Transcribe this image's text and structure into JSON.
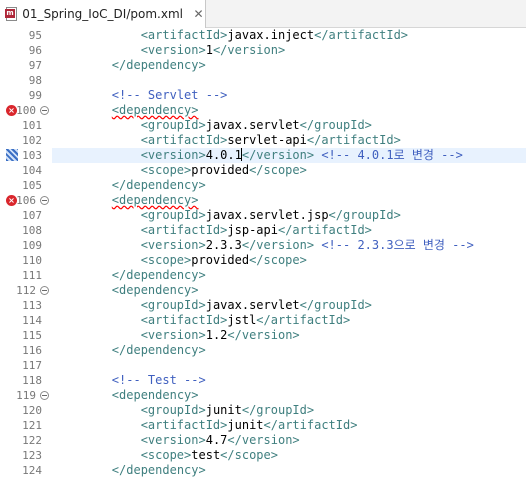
{
  "tab": {
    "title": "01_Spring_IoC_DI/pom.xml",
    "close": "✕"
  },
  "lines": [
    {
      "n": "95",
      "i": 3,
      "p": [
        [
          "t",
          "<artifactId>"
        ],
        [
          "x",
          "javax.inject"
        ],
        [
          "t",
          "</artifactId>"
        ]
      ]
    },
    {
      "n": "96",
      "i": 3,
      "p": [
        [
          "t",
          "<version>"
        ],
        [
          "x",
          "1"
        ],
        [
          "t",
          "</version>"
        ]
      ]
    },
    {
      "n": "97",
      "i": 2,
      "p": [
        [
          "t",
          "</dependency>"
        ]
      ]
    },
    {
      "n": "98",
      "i": 0,
      "p": []
    },
    {
      "n": "99",
      "i": 2,
      "p": [
        [
          "c",
          "<!-- Servlet -->"
        ]
      ]
    },
    {
      "n": "100",
      "i": 2,
      "err": true,
      "fold": true,
      "p": [
        [
          "t sq",
          "<dependency>"
        ]
      ]
    },
    {
      "n": "101",
      "i": 3,
      "p": [
        [
          "t",
          "<groupId>"
        ],
        [
          "x",
          "javax.servlet"
        ],
        [
          "t",
          "</groupId>"
        ]
      ]
    },
    {
      "n": "102",
      "i": 3,
      "p": [
        [
          "t",
          "<artifactId>"
        ],
        [
          "x",
          "servlet-api"
        ],
        [
          "t",
          "</artifactId>"
        ]
      ]
    },
    {
      "n": "103",
      "i": 3,
      "current": true,
      "occ": true,
      "p": [
        [
          "t",
          "<version>"
        ],
        [
          "x",
          "4.0.1"
        ],
        [
          "caret",
          ""
        ],
        [
          "t",
          "</version>"
        ],
        [
          "x",
          " "
        ],
        [
          "c",
          "<!-- 4.0.1로 변경 -->"
        ]
      ]
    },
    {
      "n": "104",
      "i": 3,
      "p": [
        [
          "t",
          "<scope>"
        ],
        [
          "x",
          "provided"
        ],
        [
          "t",
          "</scope>"
        ]
      ]
    },
    {
      "n": "105",
      "i": 2,
      "p": [
        [
          "t",
          "</dependency>"
        ]
      ]
    },
    {
      "n": "106",
      "i": 2,
      "err": true,
      "fold": true,
      "p": [
        [
          "t sq",
          "<dependency>"
        ]
      ]
    },
    {
      "n": "107",
      "i": 3,
      "p": [
        [
          "t",
          "<groupId>"
        ],
        [
          "x",
          "javax.servlet.jsp"
        ],
        [
          "t",
          "</groupId>"
        ]
      ]
    },
    {
      "n": "108",
      "i": 3,
      "p": [
        [
          "t",
          "<artifactId>"
        ],
        [
          "x",
          "jsp-api"
        ],
        [
          "t",
          "</artifactId>"
        ]
      ]
    },
    {
      "n": "109",
      "i": 3,
      "p": [
        [
          "t",
          "<version>"
        ],
        [
          "x",
          "2.3.3"
        ],
        [
          "t",
          "</version>"
        ],
        [
          "x",
          " "
        ],
        [
          "c",
          "<!-- 2.3.3으로 변경 -->"
        ]
      ]
    },
    {
      "n": "110",
      "i": 3,
      "p": [
        [
          "t",
          "<scope>"
        ],
        [
          "x",
          "provided"
        ],
        [
          "t",
          "</scope>"
        ]
      ]
    },
    {
      "n": "111",
      "i": 2,
      "p": [
        [
          "t",
          "</dependency>"
        ]
      ]
    },
    {
      "n": "112",
      "i": 2,
      "fold": true,
      "p": [
        [
          "t",
          "<dependency>"
        ]
      ]
    },
    {
      "n": "113",
      "i": 3,
      "p": [
        [
          "t",
          "<groupId>"
        ],
        [
          "x",
          "javax.servlet"
        ],
        [
          "t",
          "</groupId>"
        ]
      ]
    },
    {
      "n": "114",
      "i": 3,
      "p": [
        [
          "t",
          "<artifactId>"
        ],
        [
          "x",
          "jstl"
        ],
        [
          "t",
          "</artifactId>"
        ]
      ]
    },
    {
      "n": "115",
      "i": 3,
      "p": [
        [
          "t",
          "<version>"
        ],
        [
          "x",
          "1.2"
        ],
        [
          "t",
          "</version>"
        ]
      ]
    },
    {
      "n": "116",
      "i": 2,
      "p": [
        [
          "t",
          "</dependency>"
        ]
      ]
    },
    {
      "n": "117",
      "i": 0,
      "p": []
    },
    {
      "n": "118",
      "i": 2,
      "p": [
        [
          "c",
          "<!-- Test -->"
        ]
      ]
    },
    {
      "n": "119",
      "i": 2,
      "fold": true,
      "p": [
        [
          "t",
          "<dependency>"
        ]
      ]
    },
    {
      "n": "120",
      "i": 3,
      "p": [
        [
          "t",
          "<groupId>"
        ],
        [
          "x",
          "junit"
        ],
        [
          "t",
          "</groupId>"
        ]
      ]
    },
    {
      "n": "121",
      "i": 3,
      "p": [
        [
          "t",
          "<artifactId>"
        ],
        [
          "x",
          "junit"
        ],
        [
          "t",
          "</artifactId>"
        ]
      ]
    },
    {
      "n": "122",
      "i": 3,
      "p": [
        [
          "t",
          "<version>"
        ],
        [
          "x",
          "4.7"
        ],
        [
          "t",
          "</version>"
        ]
      ]
    },
    {
      "n": "123",
      "i": 3,
      "p": [
        [
          "t",
          "<scope>"
        ],
        [
          "x",
          "test"
        ],
        [
          "t",
          "</scope>"
        ]
      ]
    },
    {
      "n": "124",
      "i": 2,
      "p": [
        [
          "t",
          "</dependency>"
        ]
      ]
    }
  ]
}
